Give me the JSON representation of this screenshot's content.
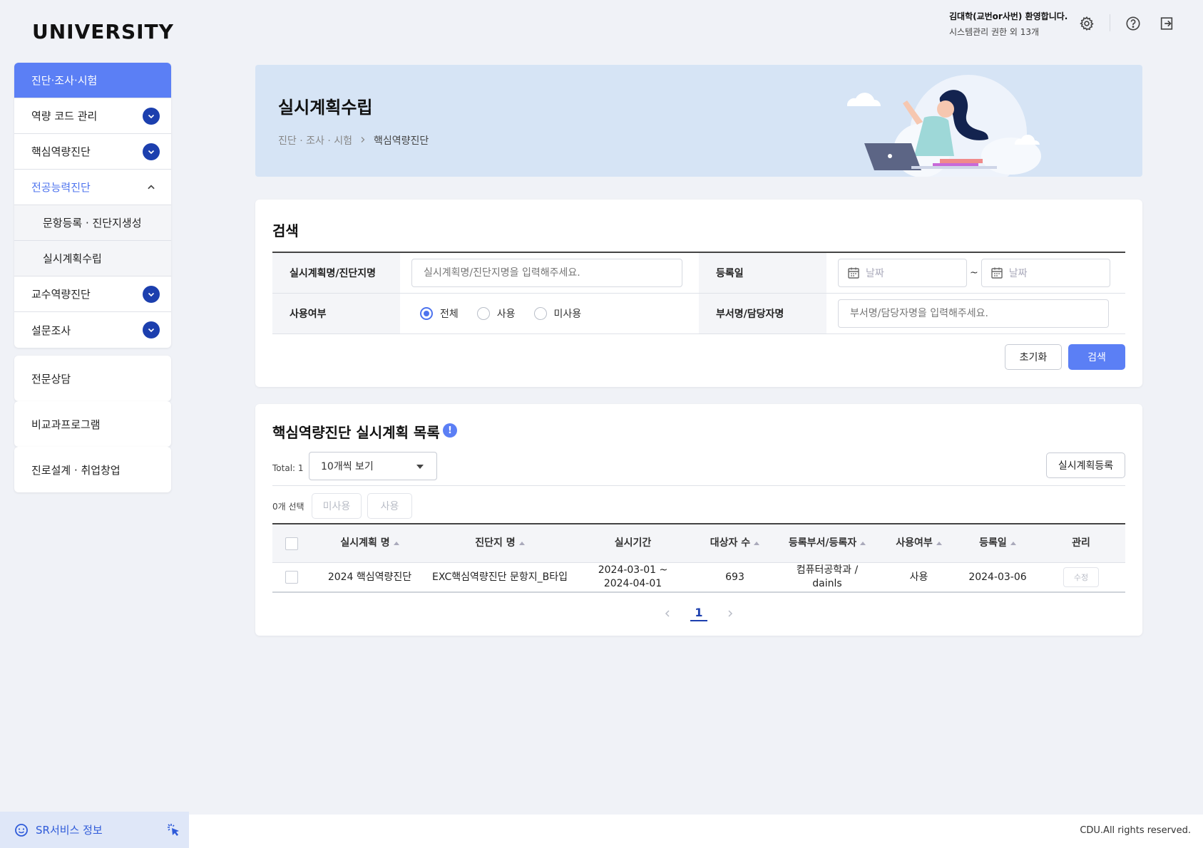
{
  "app": {
    "logo": "UNIVERSITY"
  },
  "header": {
    "user_name": "김대학(교번or사번) 환영합니다.",
    "user_role": "시스템관리 권한 외 13개",
    "icons": [
      "gear-icon",
      "help-icon",
      "logout-icon"
    ]
  },
  "sidebar": {
    "group1": [
      {
        "label": "진단·조사·시험",
        "state": "active"
      },
      {
        "label": "역량 코드 관리",
        "state": "collapsed"
      },
      {
        "label": "핵심역량진단",
        "state": "collapsed"
      },
      {
        "label": "전공능력진단",
        "state": "expanded"
      },
      {
        "label": "문항등록 · 진단지생성",
        "state": "sub"
      },
      {
        "label": "실시계획수립",
        "state": "sub"
      },
      {
        "label": "교수역량진단",
        "state": "collapsed"
      },
      {
        "label": "설문조사",
        "state": "collapsed"
      }
    ],
    "singles": [
      "전문상담",
      "비교과프로그램",
      "진로설계 · 취업창업"
    ]
  },
  "banner": {
    "title": "실시계획수립",
    "breadcrumb_root": "진단 · 조사 · 시험",
    "breadcrumb_current": "핵심역량진단"
  },
  "search": {
    "title": "검색",
    "plan_label": "실시계획명/진단지명",
    "plan_placeholder": "실시계획명/진단지명을 입력해주세요.",
    "date_label": "등록일",
    "date_from_placeholder": "날짜",
    "date_to_placeholder": "날짜",
    "date_sep": "~",
    "use_label": "사용여부",
    "use_options": [
      "전체",
      "사용",
      "미사용"
    ],
    "use_selected": "전체",
    "dept_label": "부서명/담당자명",
    "dept_placeholder": "부서명/담당자명을 입력해주세요.",
    "reset_label": "초기화",
    "search_label": "검색"
  },
  "list": {
    "title": "핵심역량진단 실시계획 목록",
    "info_icon": "!",
    "total_text": "Total: 1",
    "page_size": "10개씩 보기",
    "register_label": "실시계획등록",
    "selected_text": "0개 선택",
    "btn_unuse": "미사용",
    "btn_use": "사용",
    "columns": [
      "실시계획 명",
      "진단지 명",
      "실시기간",
      "대상자 수",
      "등록부서/등록자",
      "사용여부",
      "등록일",
      "관리"
    ],
    "rows": [
      {
        "plan": "2024 핵심역량진단",
        "form": "EXC핵심역량진단 문항지_B타입",
        "period": "2024-03-01 ~ 2024-04-01",
        "count": "693",
        "dept": "컴퓨터공학과 / dainls",
        "use": "사용",
        "date": "2024-03-06",
        "action": "수정"
      }
    ],
    "current_page": "1"
  },
  "footer": {
    "sr_label": "SR서비스 정보",
    "copyright": "CDU.All rights reserved."
  },
  "colors": {
    "primary": "#5b7ff5",
    "navy": "#1c3fae",
    "banner_bg": "#d6e4f5"
  }
}
